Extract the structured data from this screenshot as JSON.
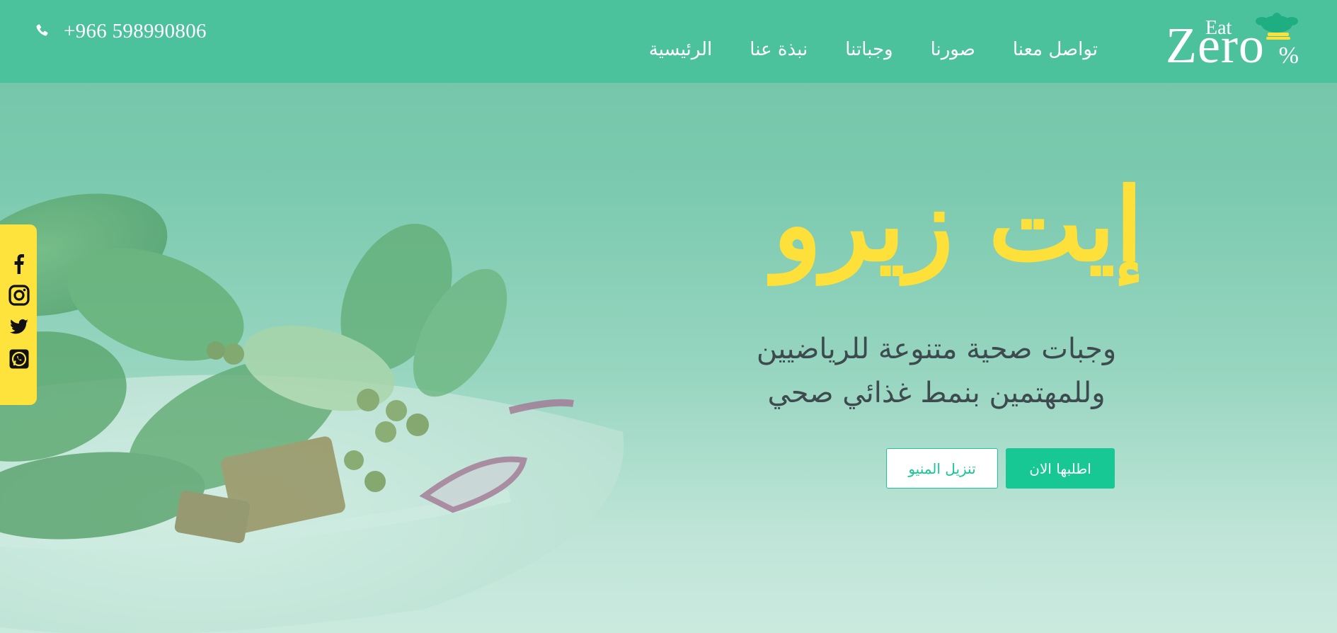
{
  "header": {
    "phone": {
      "icon": "phone-icon",
      "number": "+966 598990806"
    },
    "nav": {
      "items": [
        {
          "label": "الرئيسية"
        },
        {
          "label": "نبذة عنا"
        },
        {
          "label": "وجباتنا"
        },
        {
          "label": "صورنا"
        },
        {
          "label": "تواصل معنا"
        }
      ]
    },
    "logo": {
      "text": "Eat Zero%"
    }
  },
  "hero": {
    "title": "إيت زيرو",
    "subtitle_line1": "وجبات صحية متنوعة للرياضيين",
    "subtitle_line2": "وللمهتمين بنمط غذائي صحي",
    "order_button": "اطلبها الان",
    "menu_button": "تنزيل المنيو"
  },
  "social": {
    "icons": [
      "facebook-icon",
      "instagram-icon",
      "twitter-icon",
      "whatsapp-icon"
    ]
  },
  "colors": {
    "header_bg": "#4bc29b",
    "accent": "#17c894",
    "title_yellow": "#fde03a",
    "social_bar": "#fde33c",
    "subtitle_text": "#3d4a4e"
  }
}
